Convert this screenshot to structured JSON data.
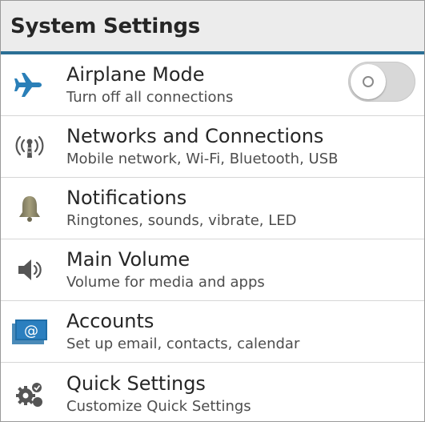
{
  "header": {
    "title": "System Settings"
  },
  "items": [
    {
      "title": "Airplane Mode",
      "subtitle": "Turn off all connections",
      "icon": "airplane-icon"
    },
    {
      "title": "Networks and Connections",
      "subtitle": "Mobile network, Wi-Fi, Bluetooth, USB",
      "icon": "antenna-icon"
    },
    {
      "title": "Notifications",
      "subtitle": "Ringtones, sounds, vibrate, LED",
      "icon": "bell-icon"
    },
    {
      "title": "Main Volume",
      "subtitle": "Volume for media and apps",
      "icon": "speaker-icon"
    },
    {
      "title": "Accounts",
      "subtitle": "Set up email, contacts, calendar",
      "icon": "at-sign-icon"
    },
    {
      "title": "Quick Settings",
      "subtitle": "Customize Quick Settings",
      "icon": "gear-check-icon"
    }
  ],
  "airplane_toggle": {
    "state": "off"
  },
  "colors": {
    "accent": "#2b6f95",
    "airplane_icon": "#2a7fb8",
    "header_bg": "#ececec",
    "toggle_bg": "#d8d8d8"
  }
}
